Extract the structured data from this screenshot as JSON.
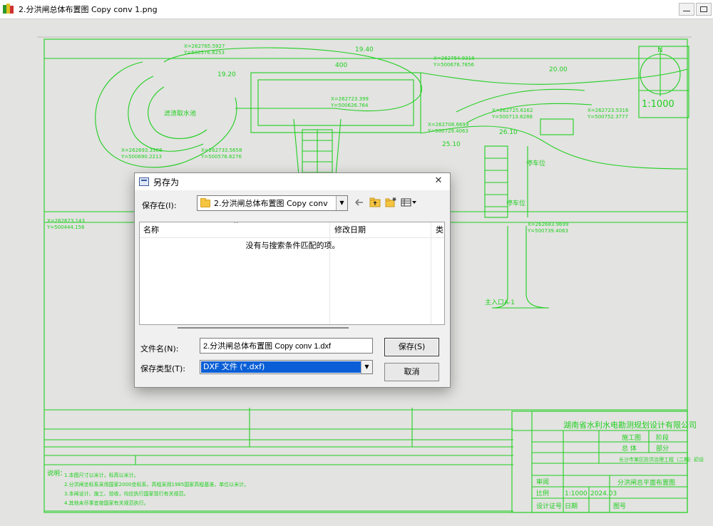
{
  "window": {
    "title": "2.分洪闸总体布置图 Copy conv 1.png"
  },
  "dialog": {
    "title": "另存为",
    "save_in_label": "保存在(I):",
    "save_in_value": "2.分洪闸总体布置图 Copy conv",
    "columns": [
      "名称",
      "修改日期",
      "类"
    ],
    "empty_message": "没有与搜索条件匹配的项。",
    "filename_label": "文件名(N):",
    "filename_value": "2.分洪闸总体布置图 Copy conv 1.dxf",
    "filetype_label": "保存类型(T):",
    "filetype_value": "DXF 文件 (*.dxf)",
    "save_button": "保存(S)",
    "cancel_button": "取消",
    "icons": [
      "back-arrow-icon",
      "up-folder-icon",
      "new-folder-icon",
      "view-menu-icon"
    ]
  },
  "drawing": {
    "scale": "1:1000",
    "north": "N",
    "company": "湖南省水利水电勘测规划设计有限公司",
    "drawing_title": "分洪闸总平面布置图",
    "project": "长沙市某区防洪治理工程（二期）初设",
    "labels": {
      "t1": "滤渍取水池",
      "t2": "停车位",
      "t3": "停车位",
      "t4": "主入口A-1",
      "t5": "说明：",
      "t6": "施工图",
      "t7": "阶段",
      "t8": "总 体",
      "t9": "部分",
      "t10": "比例",
      "t11": "1:1000",
      "t12": "图号",
      "t13": "设计证号",
      "t14": "日期",
      "t15": "2024.03",
      "t16": "审阅"
    },
    "coords": [
      "X=262765.5927",
      "Y=500576.8253",
      "X=262754.9318",
      "Y=500676.7856",
      "X=262723.399",
      "Y=500626.764",
      "X=262708.6699",
      "Y=500729.4063",
      "X=262723.5316",
      "Y=500752.3777",
      "X=262725.6162",
      "Y=500713.6288",
      "X=262733.5658",
      "Y=500576.6276",
      "X=262693.3368",
      "Y=500690.2213",
      "X=262673.143",
      "Y=500444.156",
      "X=262683.9699",
      "Y=500739.4063"
    ],
    "dims": [
      "400",
      "20.00",
      "26.10",
      "19.20",
      "19.40",
      "25.10"
    ],
    "notes": [
      "1.本图尺寸以米计，标高以米计。",
      "2.分洪闸坐标系采用国家2000坐标系，高程采用1985国家高程基准，单位以米计。",
      "3.本闸设计、施工、验收，均应执行国家现行有关规范。",
      "4.其他未尽事宜按国家有关规范执行。"
    ]
  }
}
